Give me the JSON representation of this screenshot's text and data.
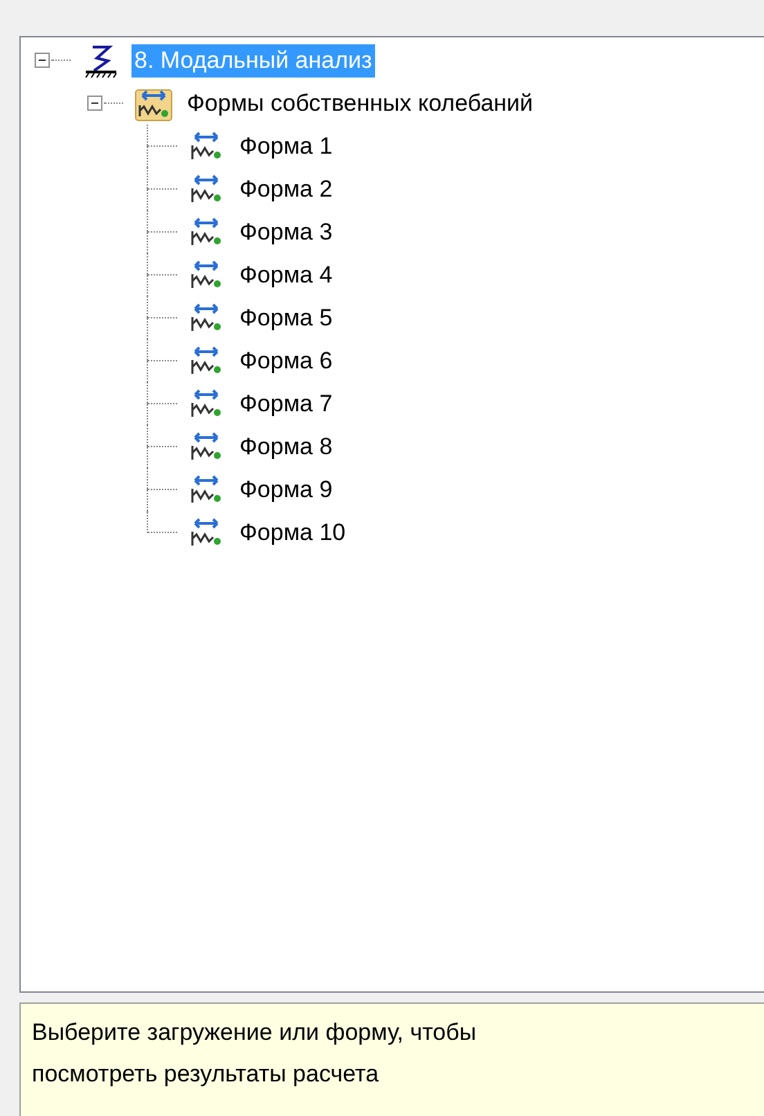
{
  "tree": [
    {
      "label": "8. Модальный анализ",
      "kind": "analysis",
      "selected": true,
      "expanded": true,
      "children": [
        {
          "label": "Формы собственных колебаний",
          "kind": "folder",
          "selected": false,
          "expanded": true,
          "children": [
            {
              "label": "Форма 1",
              "kind": "mode",
              "selected": false
            },
            {
              "label": "Форма 2",
              "kind": "mode",
              "selected": false
            },
            {
              "label": "Форма 3",
              "kind": "mode",
              "selected": false
            },
            {
              "label": "Форма 4",
              "kind": "mode",
              "selected": false
            },
            {
              "label": "Форма 5",
              "kind": "mode",
              "selected": false
            },
            {
              "label": "Форма 6",
              "kind": "mode",
              "selected": false
            },
            {
              "label": "Форма 7",
              "kind": "mode",
              "selected": false
            },
            {
              "label": "Форма 8",
              "kind": "mode",
              "selected": false
            },
            {
              "label": "Форма 9",
              "kind": "mode",
              "selected": false
            },
            {
              "label": "Форма 10",
              "kind": "mode",
              "selected": false
            }
          ]
        }
      ]
    }
  ],
  "hint": "Выберите загружение или форму, чтобы посмотреть результаты расчета"
}
